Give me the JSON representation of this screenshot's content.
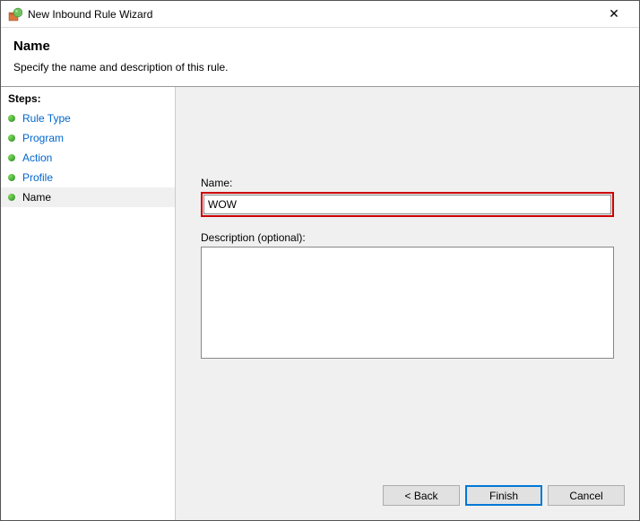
{
  "window": {
    "title": "New Inbound Rule Wizard",
    "close_symbol": "✕"
  },
  "header": {
    "title": "Name",
    "subtitle": "Specify the name and description of this rule."
  },
  "sidebar": {
    "header": "Steps:",
    "items": [
      {
        "label": "Rule Type",
        "state": "completed"
      },
      {
        "label": "Program",
        "state": "completed"
      },
      {
        "label": "Action",
        "state": "completed"
      },
      {
        "label": "Profile",
        "state": "completed"
      },
      {
        "label": "Name",
        "state": "current"
      }
    ]
  },
  "form": {
    "name_label": "Name:",
    "name_value": "WOW",
    "desc_label": "Description (optional):",
    "desc_value": ""
  },
  "buttons": {
    "back": "< Back",
    "finish": "Finish",
    "cancel": "Cancel"
  }
}
